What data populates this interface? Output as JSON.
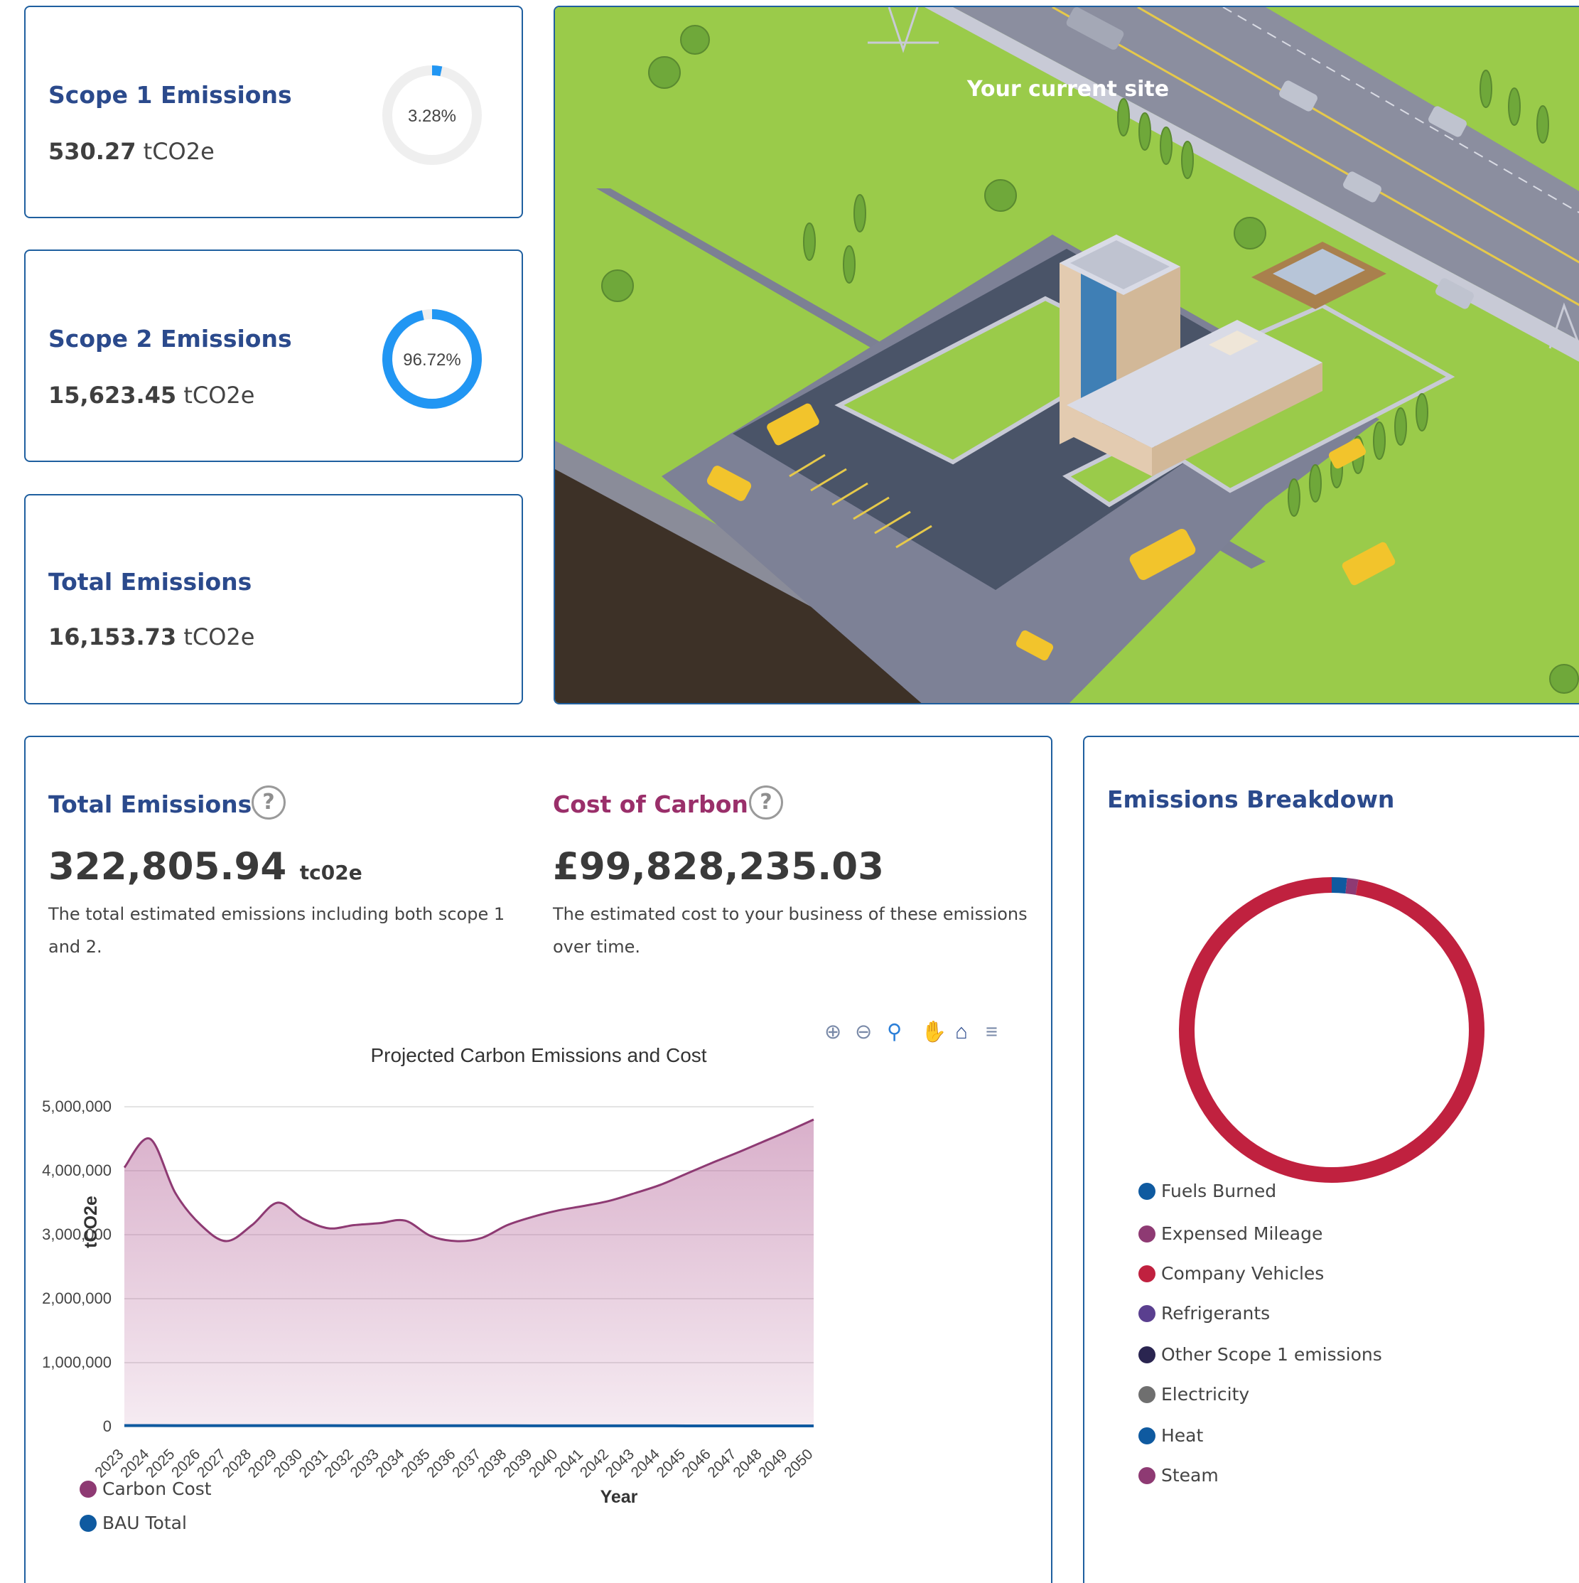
{
  "scope1": {
    "title": "Scope 1 Emissions",
    "value": "530.27",
    "unit": "tCO2e",
    "percent_label": "3.28%",
    "percent": 3.28
  },
  "scope2": {
    "title": "Scope 2 Emissions",
    "value": "15,623.45",
    "unit": "tCO2e",
    "percent_label": "96.72%",
    "percent": 96.72
  },
  "total": {
    "title": "Total Emissions",
    "value": "16,153.73",
    "unit": "tCO2e"
  },
  "site": {
    "label": "Your current site"
  },
  "projection": {
    "emissions_title": "Total Emissions",
    "emissions_value": "322,805.94",
    "emissions_unit": "tc02e",
    "emissions_desc": "The total estimated emissions including both scope 1 and 2.",
    "cost_title": "Cost of Carbon",
    "cost_value": "£99,828,235.03",
    "cost_desc": "The estimated cost to your business of these emissions over time.",
    "help_glyph": "?"
  },
  "toolbar_icons": [
    "zoom-in-icon",
    "zoom-out-icon",
    "zoom-search-icon",
    "pan-hand-icon",
    "home-icon",
    "menu-icon"
  ],
  "chart_data": {
    "type": "area",
    "title": "Projected Carbon Emissions and Cost",
    "xlabel": "Year",
    "ylabel": "tCO2e",
    "ylim": [
      0,
      5000000
    ],
    "y_ticks": [
      "5,000,000",
      "4,000,000",
      "3,000,000",
      "2,000,000",
      "1,000,000",
      "0"
    ],
    "y_tick_values": [
      5000000,
      4000000,
      3000000,
      2000000,
      1000000,
      0
    ],
    "grid": true,
    "legend_position": "bottom-left",
    "x": [
      "2023",
      "2024",
      "2025",
      "2026",
      "2027",
      "2028",
      "2029",
      "2030",
      "2031",
      "2032",
      "2033",
      "2034",
      "2035",
      "2036",
      "2037",
      "2038",
      "2039",
      "2040",
      "2041",
      "2042",
      "2043",
      "2044",
      "2045",
      "2046",
      "2047",
      "2048",
      "2049",
      "2050"
    ],
    "series": [
      {
        "name": "Carbon Cost",
        "color": "#8e3a73",
        "values": [
          4050000,
          4500000,
          3650000,
          3150000,
          2900000,
          3150000,
          3500000,
          3250000,
          3100000,
          3150000,
          3180000,
          3220000,
          2980000,
          2900000,
          2950000,
          3150000,
          3280000,
          3380000,
          3450000,
          3530000,
          3650000,
          3780000,
          3950000,
          4120000,
          4280000,
          4450000,
          4620000,
          4800000
        ]
      },
      {
        "name": "BAU Total",
        "color": "#0f5aa0",
        "values": [
          16154,
          16000,
          15800,
          15500,
          15300,
          15100,
          15000,
          14800,
          14600,
          14400,
          14200,
          14000,
          13800,
          13600,
          13400,
          13200,
          13000,
          12800,
          12600,
          12400,
          12200,
          12000,
          11800,
          11600,
          11400,
          11200,
          11000,
          10800
        ]
      }
    ]
  },
  "breakdown": {
    "title": "Emissions Breakdown",
    "chart_data": {
      "type": "pie",
      "categories": [
        "Fuels Burned",
        "Expensed Mileage",
        "Company Vehicles",
        "Refrigerants",
        "Other Scope 1 emissions",
        "Electricity",
        "Heat",
        "Steam"
      ],
      "values": [
        1.6,
        1.2,
        97.2,
        0,
        0,
        0,
        0,
        0
      ],
      "colors": [
        "#0f5aa0",
        "#8e3a73",
        "#c0213f",
        "#5a3f8f",
        "#2a2550",
        "#6f6f6f",
        "#0f5aa0",
        "#8e3a73"
      ]
    }
  }
}
